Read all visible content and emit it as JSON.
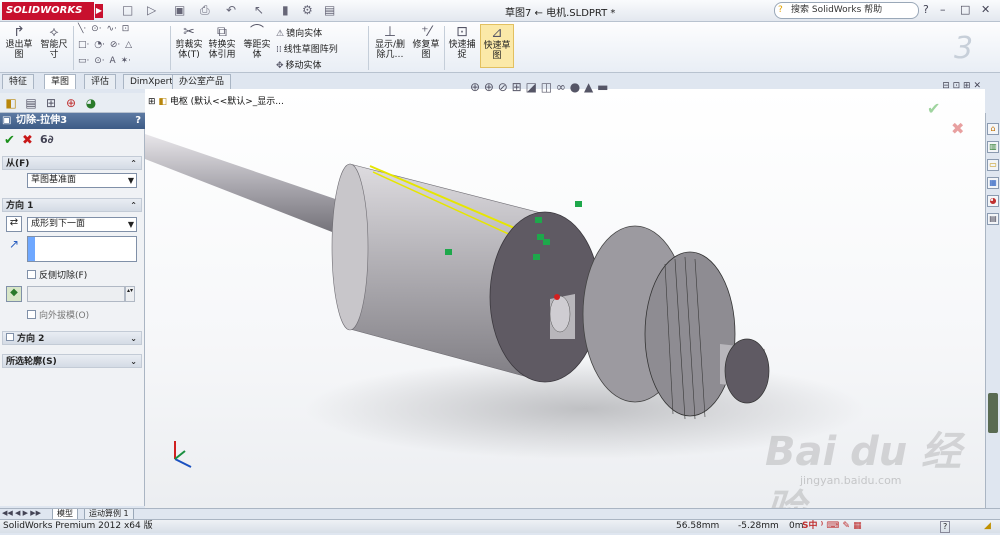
{
  "app": {
    "logo": "SOLIDWORKS",
    "doc_title": "草图7 ← 电机.SLDPRT *",
    "help_placeholder": "搜索 SolidWorks 帮助"
  },
  "quick_access": [
    "□",
    "▷",
    "▣",
    "🖶",
    "↶",
    "⬚",
    "⚙",
    "▤"
  ],
  "ribbon": {
    "exit_sketch": "退出草\n图",
    "smart_dim": "智能尺\n寸",
    "trim": "剪裁实\n体(T)",
    "convert": "转换实\n体引用",
    "offset": "等距实\n体",
    "mirror": "镜向实体",
    "linear_pattern": "线性草图阵列",
    "move": "移动实体",
    "show_delete": "显示/删\n除几…",
    "repair": "修复草\n图",
    "quick_snap": "快速捕\n捉",
    "rapid_sketch": "快速草\n图"
  },
  "tabs": [
    "特征",
    "草图",
    "评估",
    "DimXpert",
    "办公室产品"
  ],
  "active_tab": "草图",
  "property_manager": {
    "title": "切除-拉伸3",
    "help": "?",
    "from_section": "从(F)",
    "from_value": "草图基准面",
    "dir1_section": "方向 1",
    "dir1_end": "成形到下一面",
    "flip_side": "反侧切除(F)",
    "draft_outward": "向外拔模(O)",
    "dir2_section": "方向 2",
    "contours_section": "所选轮廓(S)"
  },
  "tree": {
    "root": "电枢 (默认<<默认>_显示..."
  },
  "bottom_tabs": [
    "模型",
    "运动算例 1"
  ],
  "status": {
    "product": "SolidWorks Premium 2012 x64 版",
    "x": "56.58mm",
    "y": "-5.28mm",
    "z": "0m"
  },
  "watermark": {
    "brand": "Bai du 经验",
    "url": "jingyan.baidu.com"
  },
  "colors": {
    "accent": "#3d5b85",
    "logo_red": "#c8102e",
    "green_ok": "#1a8f1a",
    "red_x": "#c81818",
    "highlight": "#e6e600"
  }
}
